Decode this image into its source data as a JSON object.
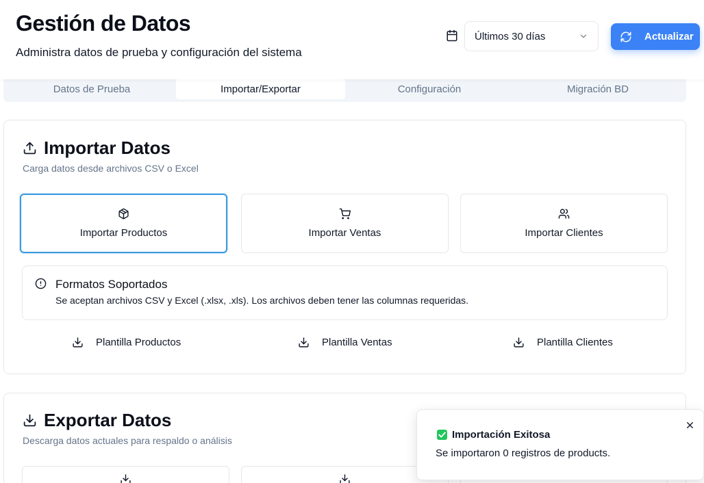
{
  "header": {
    "title": "Gestión de Datos",
    "subtitle": "Administra datos de prueba y configuración del sistema",
    "date_range": "Últimos 30 días",
    "refresh_label": "Actualizar"
  },
  "tabs": [
    {
      "label": "Datos de Prueba",
      "active": false
    },
    {
      "label": "Importar/Exportar",
      "active": true
    },
    {
      "label": "Configuración",
      "active": false
    },
    {
      "label": "Migración BD",
      "active": false
    }
  ],
  "import_section": {
    "title": "Importar Datos",
    "description": "Carga datos desde archivos CSV o Excel",
    "options": [
      {
        "label": "Importar Productos",
        "icon": "package-icon"
      },
      {
        "label": "Importar Ventas",
        "icon": "cart-icon"
      },
      {
        "label": "Importar Clientes",
        "icon": "users-icon"
      }
    ],
    "alert": {
      "title": "Formatos Soportados",
      "text": "Se aceptan archivos CSV y Excel (.xlsx, .xls). Los archivos deben tener las columnas requeridas."
    },
    "templates": [
      {
        "label": "Plantilla Productos"
      },
      {
        "label": "Plantilla Ventas"
      },
      {
        "label": "Plantilla Clientes"
      }
    ]
  },
  "export_section": {
    "title": "Exportar Datos",
    "description": "Descarga datos actuales para respaldo o análisis"
  },
  "toast": {
    "title": "Importación Exitosa",
    "message": "Se importaron 0 registros de products."
  },
  "colors": {
    "primary": "#3b82f6",
    "success": "#22c55e",
    "muted_text": "#64748b"
  }
}
